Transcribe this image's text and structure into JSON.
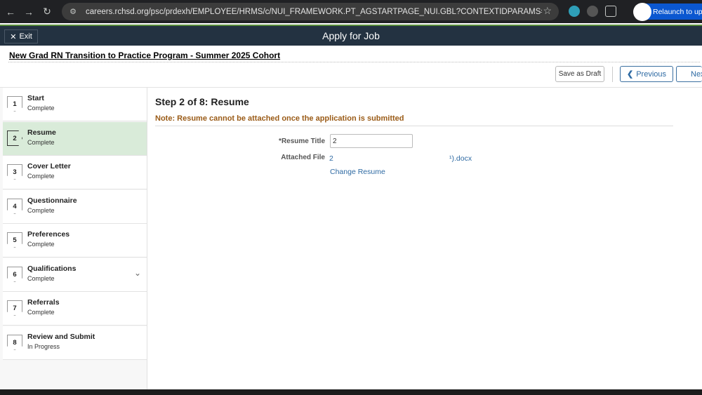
{
  "browser": {
    "url": "careers.rchsd.org/psc/prdexh/EMPLOYEE/HRMS/c/NUI_FRAMEWORK.PT_AGSTARTPAGE_NUI.GBL?CONTEXTIDPARAMS=TEMPLATE_I...",
    "relaunch_label": "Relaunch to upd"
  },
  "header": {
    "exit_label": "Exit",
    "title": "Apply for Job"
  },
  "job": {
    "title": "New Grad RN Transition to Practice Program - Summer 2025 Cohort"
  },
  "toolbar": {
    "save_draft": "Save as Draft",
    "previous": "Previous",
    "next": "Next"
  },
  "steps": [
    {
      "num": "1",
      "label": "Start",
      "status": "Complete"
    },
    {
      "num": "2",
      "label": "Resume",
      "status": "Complete"
    },
    {
      "num": "3",
      "label": "Cover Letter",
      "status": "Complete"
    },
    {
      "num": "4",
      "label": "Questionnaire",
      "status": "Complete"
    },
    {
      "num": "5",
      "label": "Preferences",
      "status": "Complete"
    },
    {
      "num": "6",
      "label": "Qualifications",
      "status": "Complete"
    },
    {
      "num": "7",
      "label": "Referrals",
      "status": "Complete"
    },
    {
      "num": "8",
      "label": "Review and Submit",
      "status": "In Progress"
    }
  ],
  "main": {
    "heading": "Step 2 of 8: Resume",
    "note": "Note: Resume cannot be attached once the application is submitted",
    "resume_title_label": "*Resume Title",
    "resume_title_value": "2",
    "attached_file_label": "Attached File",
    "attached_file_prefix": "2",
    "attached_file_suffix": "¹).docx",
    "change_resume": "Change Resume"
  },
  "colors": {
    "header_bg": "#233241",
    "active_step_bg": "#d9ebd9",
    "note_color": "#9a5b17",
    "link_color": "#2e6aa3"
  }
}
